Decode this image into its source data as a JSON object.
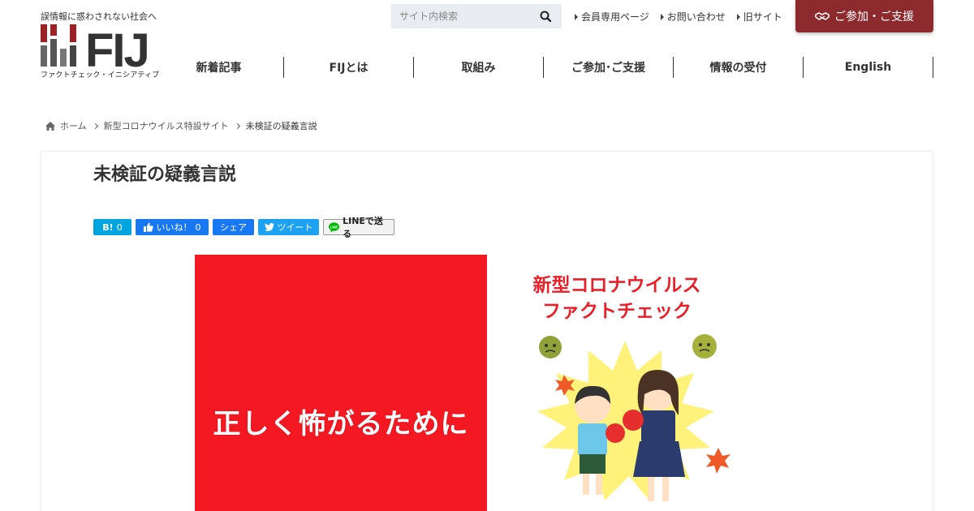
{
  "header": {
    "tagline": "誤情報に惑わされない社会へ",
    "logo_text": "FIJ",
    "logo_subtitle": "ファクトチェック・イニシアティブ",
    "brand_color": "#8c2a2e"
  },
  "search": {
    "placeholder": "サイト内検索"
  },
  "top_links": [
    {
      "label": "会員専用ページ"
    },
    {
      "label": "お問い合わせ"
    },
    {
      "label": "旧サイト"
    }
  ],
  "cta": {
    "label": "ご参加・ご支援",
    "color": "#8c2a2e"
  },
  "nav": [
    {
      "label": "新着記事"
    },
    {
      "label": "FIJとは"
    },
    {
      "label": "取組み"
    },
    {
      "label": "ご参加･ご支援"
    },
    {
      "label": "情報の受付"
    },
    {
      "label": "English"
    }
  ],
  "breadcrumb": {
    "home": "ホーム",
    "parent": "新型コロナウイルス特設サイト",
    "current": "未検証の疑義言説"
  },
  "article": {
    "title": "未検証の疑義言説"
  },
  "share": {
    "hatena_label": "B!",
    "hatena_count": "0",
    "like_label": "いいね！",
    "like_count": "0",
    "share_label": "シェア",
    "tweet_label": "ツイート",
    "line_label": "LINEで送る"
  },
  "featured": {
    "left_text": "正しく怖がるために",
    "right_title_line1": "新型コロナウイルス",
    "right_title_line2": "ファクトチェック",
    "left_bg": "#f41822",
    "title_color": "#e8202a"
  }
}
